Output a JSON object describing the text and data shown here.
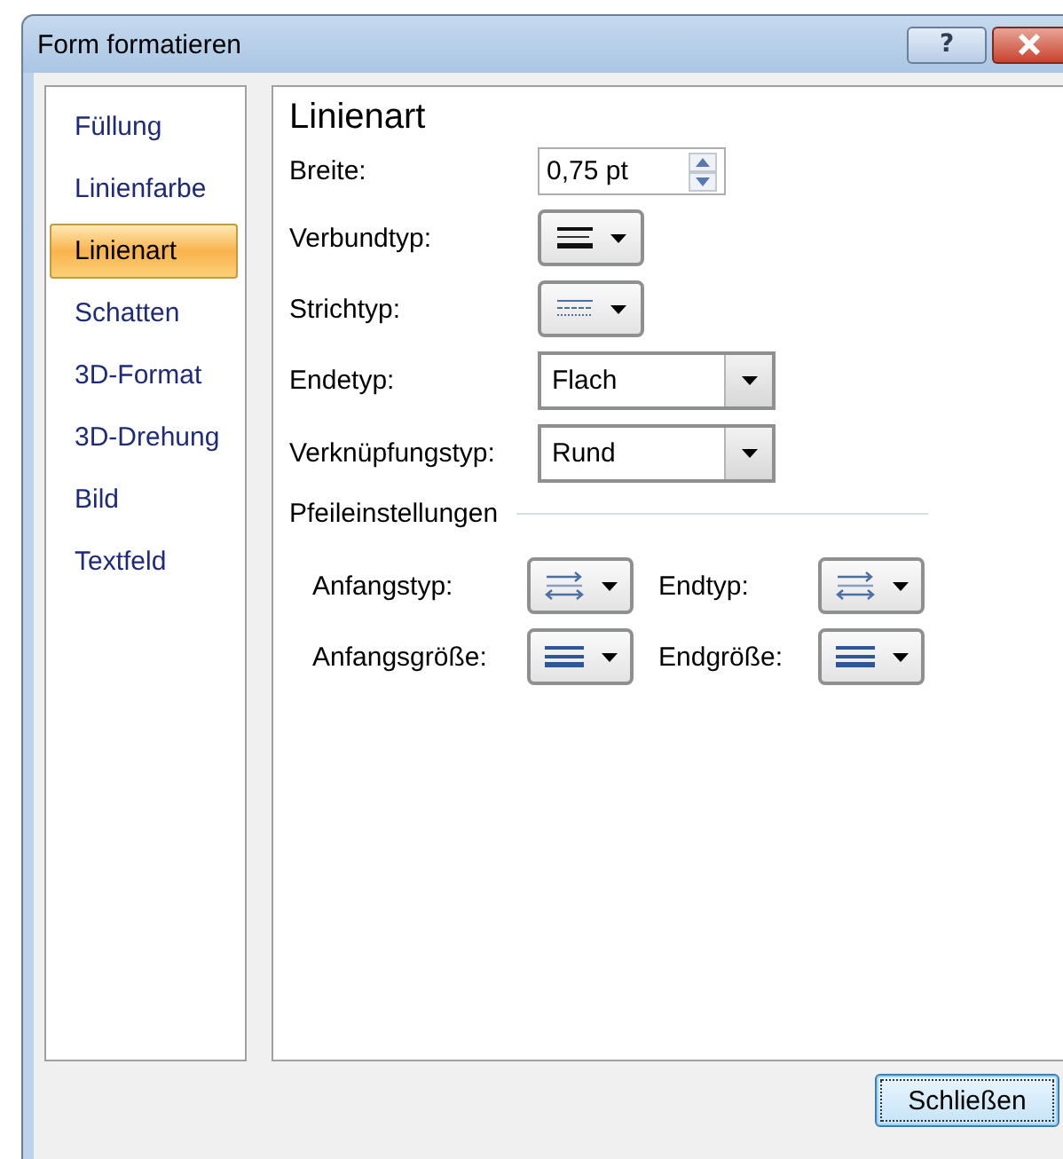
{
  "window": {
    "title": "Form formatieren",
    "help_label": "?"
  },
  "categories": [
    {
      "label": "Füllung",
      "selected": false
    },
    {
      "label": "Linienfarbe",
      "selected": false
    },
    {
      "label": "Linienart",
      "selected": true
    },
    {
      "label": "Schatten",
      "selected": false
    },
    {
      "label": "3D-Format",
      "selected": false
    },
    {
      "label": "3D-Drehung",
      "selected": false
    },
    {
      "label": "Bild",
      "selected": false
    },
    {
      "label": "Textfeld",
      "selected": false
    }
  ],
  "panel": {
    "heading": "Linienart",
    "fields": [
      {
        "label": "Breite:",
        "kind": "spinner",
        "value": "0,75 pt"
      },
      {
        "label": "Verbundtyp:",
        "kind": "compound"
      },
      {
        "label": "Strichtyp:",
        "kind": "dash"
      },
      {
        "label": "Endetyp:",
        "kind": "combo",
        "value": "Flach"
      },
      {
        "label": "Verknüpfungstyp:",
        "kind": "combo",
        "value": "Rund"
      }
    ],
    "arrows": {
      "heading": "Pfeileinstellungen",
      "fields": [
        {
          "label": "Anfangstyp:",
          "kind": "arrowtype"
        },
        {
          "label": "Endtyp:",
          "kind": "arrowtype"
        },
        {
          "label": "Anfangsgröße:",
          "kind": "arrowsize"
        },
        {
          "label": "Endgröße:",
          "kind": "arrowsize"
        }
      ]
    }
  },
  "close_button": {
    "label": "Schließen"
  }
}
